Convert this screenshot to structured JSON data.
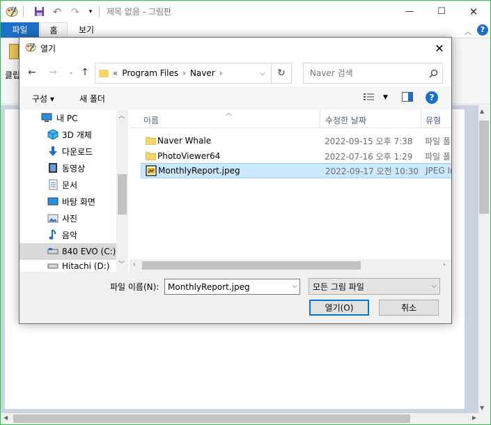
{
  "paint": {
    "title": "제목 없음 - 그림판",
    "tabs": {
      "file": "파일",
      "home": "홈",
      "view": "보기"
    },
    "clipboard_label": "클립"
  },
  "dialog": {
    "title": "열기",
    "breadcrumbs": [
      "«",
      "Program Files",
      "›",
      "Naver",
      "›"
    ],
    "search_placeholder": "Naver 검색",
    "toolbar": {
      "organize": "구성 ▾",
      "new_folder": "새 폴더"
    },
    "tree": [
      {
        "label": "내 PC",
        "icon": "pc-icon"
      },
      {
        "label": "3D 개체",
        "icon": "cube-3d-icon"
      },
      {
        "label": "다운로드",
        "icon": "download-icon"
      },
      {
        "label": "동영상",
        "icon": "video-icon"
      },
      {
        "label": "문서",
        "icon": "document-icon"
      },
      {
        "label": "바탕 화면",
        "icon": "desktop-icon"
      },
      {
        "label": "사진",
        "icon": "picture-icon"
      },
      {
        "label": "음악",
        "icon": "music-icon"
      },
      {
        "label": "840 EVO (C:)",
        "icon": "drive-icon"
      },
      {
        "label": "Hitachi (D:)",
        "icon": "drive-icon"
      }
    ],
    "columns": {
      "name": "이름",
      "date": "수정한 날짜",
      "type": "유형"
    },
    "files": [
      {
        "name": "Naver Whale",
        "date": "2022-09-15 오후 7:38",
        "type": "파일 폴",
        "icon": "folder-icon"
      },
      {
        "name": "PhotoViewer64",
        "date": "2022-07-16 오후 1:29",
        "type": "파일 폴",
        "icon": "folder-icon"
      },
      {
        "name": "MonthlyReport.jpeg",
        "date": "2022-09-17 오전 10:30",
        "type": "JPEG Im",
        "icon": "jpeg-file-icon"
      }
    ],
    "filename_label": "파일 이름(N):",
    "filename_value": "MonthlyReport.jpeg",
    "filter_value": "모든 그림 파일",
    "open_label": "열기(O)",
    "cancel_label": "취소"
  },
  "colors": {
    "accent": "#1e6fc7",
    "selection": "#cce8ff",
    "border_green": "#2bbf4c"
  }
}
